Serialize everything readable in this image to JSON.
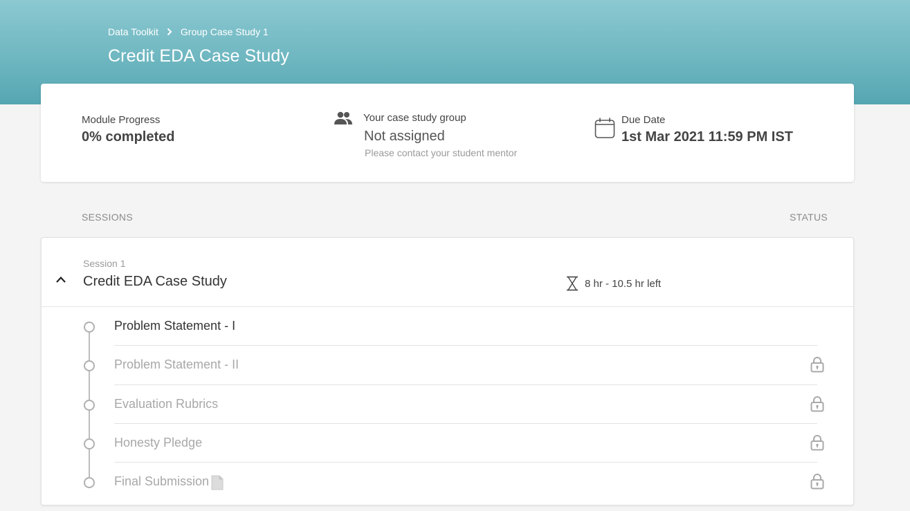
{
  "header": {
    "breadcrumb": [
      "Data Toolkit",
      "Group Case Study 1"
    ],
    "title": "Credit EDA Case Study",
    "colors": {
      "gradient_top": "#8cc9d1",
      "gradient_bottom": "#55a6b2"
    }
  },
  "summary": {
    "progress_label": "Module Progress",
    "progress_value": "0% completed",
    "group_label": "Your case study group",
    "group_value": "Not assigned",
    "group_note": "Please contact your student mentor",
    "due_label": "Due Date",
    "due_value": "1st Mar 2021 11:59 PM IST"
  },
  "sessions_header": {
    "left": "SESSIONS",
    "right": "STATUS"
  },
  "session": {
    "number_label": "Session 1",
    "title": "Credit EDA Case Study",
    "time_left": "8 hr - 10.5 hr left",
    "items": [
      {
        "label": "Problem Statement - I",
        "status": "unlocked"
      },
      {
        "label": "Problem Statement - II",
        "status": "locked"
      },
      {
        "label": "Evaluation Rubrics",
        "status": "locked"
      },
      {
        "label": "Honesty Pledge",
        "status": "locked"
      },
      {
        "label": "Final Submission",
        "status": "locked",
        "icon": "document-icon"
      }
    ]
  }
}
